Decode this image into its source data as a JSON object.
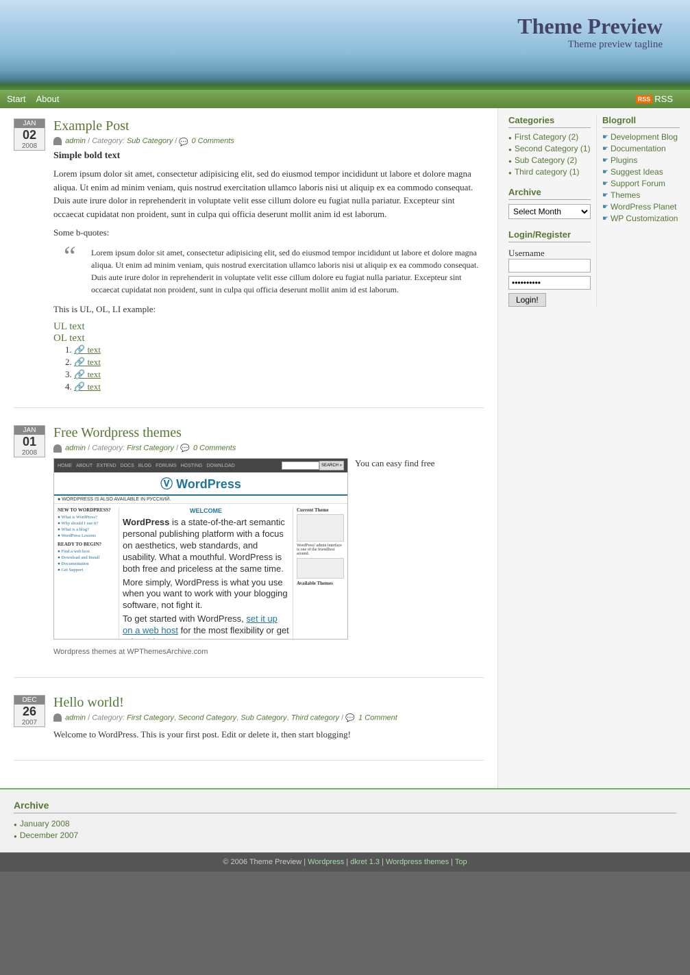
{
  "header": {
    "title": "Theme Preview",
    "tagline": "Theme preview tagline"
  },
  "nav": {
    "items": [
      {
        "label": "Start",
        "href": "#"
      },
      {
        "label": "About",
        "href": "#"
      }
    ],
    "rss_label": "RSS",
    "rss_href": "#"
  },
  "posts": [
    {
      "id": "example-post",
      "date_month": "JAN",
      "date_day": "02",
      "date_year": "2008",
      "title": "Example Post",
      "title_href": "#",
      "meta_author": "admin",
      "meta_category_label": "Category:",
      "meta_category": "Sub Category",
      "meta_comments": "0 Comments",
      "content_bold": "Simple bold text",
      "content_lorem": "Lorem ipsum dolor sit amet, consectetur adipisicing elit, sed do eiusmod tempor incididunt ut labore et dolore magna aliqua. Ut enim ad minim veniam, quis nostrud exercitation ullamco laboris nisi ut aliquip ex ea commodo consequat. Duis aute irure dolor in reprehenderit in voluptate velit esse cillum dolore eu fugiat nulla pariatur. Excepteur sint occaecat cupidatat non proident, sunt in culpa qui officia deserunt mollit anim id est laborum.",
      "blockquote_intro": "Some b-quotes:",
      "blockquote_text": "Lorem ipsum dolor sit amet, consectetur adipisicing elit, sed do eiusmod tempor incididunt ut labore et dolore magna aliqua. Ut enim ad minim veniam, quis nostrud exercitation ullamco laboris nisi ut aliquip ex ea commodo consequat. Duis aute irure dolor in reprehenderit in voluptate velit esse cillum dolore eu fugiat nulla pariatur. Excepteur sint occaecat cupidatat non proident, sunt in culpa qui officia deserunt mollit anim id est laborum.",
      "list_intro": "This is UL, OL, LI example:",
      "ul_text": "UL text",
      "ol_text": "OL text",
      "ol_items": [
        "text",
        "text",
        "text",
        "text"
      ]
    },
    {
      "id": "free-wordpress-themes",
      "date_month": "JAN",
      "date_day": "01",
      "date_year": "2008",
      "title": "Free Wordpress themes",
      "title_href": "#",
      "meta_author": "admin",
      "meta_category_label": "Category:",
      "meta_category": "First Category",
      "meta_comments": "0 Comments",
      "aside_text": "You can easy find free",
      "screenshot_caption": "Wordpress themes at WPThemesArchive.com"
    },
    {
      "id": "hello-world",
      "date_month": "DEC",
      "date_day": "26",
      "date_year": "2007",
      "title": "Hello world!",
      "title_href": "#",
      "meta_author": "admin",
      "meta_category_label": "Category:",
      "meta_categories": [
        "First Category",
        "Second Category",
        "Sub Category",
        "Third category"
      ],
      "meta_comments": "1 Comment",
      "content_text": "Welcome to WordPress. This is your first post. Edit or delete it, then start blogging!"
    }
  ],
  "sidebar": {
    "categories_heading": "Categories",
    "categories": [
      {
        "label": "First Category (2)",
        "href": "#"
      },
      {
        "label": "Second Category (1)",
        "href": "#"
      },
      {
        "label": "Sub Category (2)",
        "href": "#"
      },
      {
        "label": "Third category (1)",
        "href": "#"
      }
    ],
    "blogroll_heading": "Blogroll",
    "blogroll": [
      {
        "label": "Development Blog",
        "href": "#"
      },
      {
        "label": "Documentation",
        "href": "#"
      },
      {
        "label": "Plugins",
        "href": "#"
      },
      {
        "label": "Suggest Ideas",
        "href": "#"
      },
      {
        "label": "Support Forum",
        "href": "#"
      },
      {
        "label": "Themes",
        "href": "#"
      },
      {
        "label": "WordPress Planet",
        "href": "#"
      },
      {
        "label": "WP Customization",
        "href": "#"
      }
    ],
    "archive_heading": "Archive",
    "archive_select_default": "Select Month",
    "login_heading": "Login/Register",
    "login_username_label": "Username",
    "login_password_placeholder": "••••••••••",
    "login_button": "Login!"
  },
  "footer_archive": {
    "heading": "Archive",
    "items": [
      {
        "label": "January 2008",
        "href": "#"
      },
      {
        "label": "December 2007",
        "href": "#"
      }
    ]
  },
  "footer": {
    "copyright": "© 2006 Theme Preview |",
    "links": [
      {
        "label": "Wordpress",
        "href": "#"
      },
      {
        "label": "dkret 1.3",
        "href": "#"
      },
      {
        "label": "Wordpress themes",
        "href": "#"
      },
      {
        "label": "Top",
        "href": "#"
      }
    ]
  },
  "wp_screenshot": {
    "nav_items": [
      "HOME",
      "ABOUT",
      "EXTEND",
      "DOCS",
      "BLOG",
      "FORUMS",
      "HOSTING",
      "DOWNLOAD"
    ],
    "search_btn": "SEARCH »",
    "notice": "● WORDPRESS IS ALSO AVAILABLE IN РУССКИЙ.",
    "welcome_title": "WELCOME",
    "welcome_text": "WordPress is a state-of-the-art semantic personal publishing platform with a focus on aesthetics, web standards, and usability. What a mouthful. WordPress is both free and priceless at the same time.",
    "welcome_text2": "More simply, WordPress is what you use when you want to work with your blogging software, not fight it.",
    "welcome_text3": "To get started with WordPress, set it up on a web host for the most flexibility or get a free blog on WordPress.com.",
    "sidebar_links": [
      "What is WordPress?",
      "Why should I use it?",
      "What is a blog?",
      "WordPress Lessons"
    ],
    "sidebar_title": "NEW TO WORDPRESS?",
    "sidebar_title2": "READY TO BEGIN?",
    "sidebar_links2": [
      "Find a web host",
      "Download and Install",
      "Documentation",
      "Get Support"
    ],
    "current_theme_label": "Current Theme"
  }
}
